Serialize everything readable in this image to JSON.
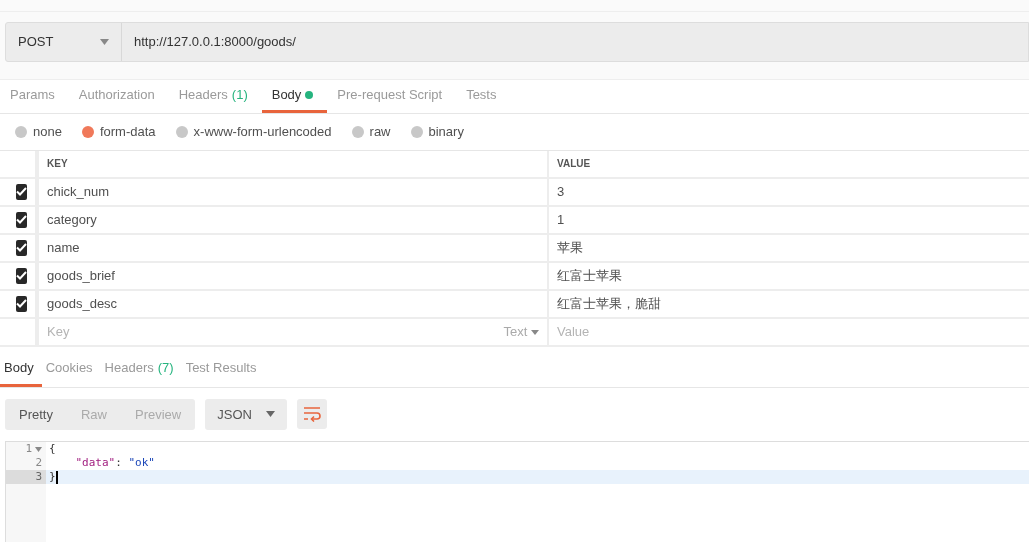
{
  "request": {
    "method": "POST",
    "url": "http://127.0.0.1:8000/goods/"
  },
  "request_tabs": [
    {
      "label": "Params",
      "selected": false
    },
    {
      "label": "Authorization",
      "selected": false
    },
    {
      "label": "Headers",
      "count": "(1)",
      "selected": false
    },
    {
      "label": "Body",
      "dot": true,
      "selected": true
    },
    {
      "label": "Pre-request Script",
      "selected": false
    },
    {
      "label": "Tests",
      "selected": false
    }
  ],
  "body_types": [
    {
      "label": "none",
      "selected": false
    },
    {
      "label": "form-data",
      "selected": true
    },
    {
      "label": "x-www-form-urlencoded",
      "selected": false
    },
    {
      "label": "raw",
      "selected": false
    },
    {
      "label": "binary",
      "selected": false
    }
  ],
  "params": {
    "columns": [
      "KEY",
      "VALUE"
    ],
    "rows": [
      {
        "key": "chick_num",
        "value": "3",
        "checked": true
      },
      {
        "key": "category",
        "value": "1",
        "checked": true
      },
      {
        "key": "name",
        "value": "苹果",
        "checked": true
      },
      {
        "key": "goods_brief",
        "value": "红富士苹果",
        "checked": true
      },
      {
        "key": "goods_desc",
        "value": "红富士苹果，脆甜",
        "checked": true
      }
    ],
    "new_row": {
      "key_placeholder": "Key",
      "type": "Text",
      "value_placeholder": "Value"
    }
  },
  "response_tabs": [
    {
      "label": "Body",
      "selected": true
    },
    {
      "label": "Cookies",
      "selected": false
    },
    {
      "label": "Headers",
      "count": "(7)",
      "selected": false
    },
    {
      "label": "Test Results",
      "selected": false
    }
  ],
  "view_modes": [
    {
      "label": "Pretty",
      "selected": true
    },
    {
      "label": "Raw",
      "selected": false
    },
    {
      "label": "Preview",
      "selected": false
    }
  ],
  "format": "JSON",
  "code": [
    {
      "number": "1",
      "foldable": true,
      "selected": false,
      "tokens": [
        {
          "kind": "punct",
          "text": "{"
        }
      ]
    },
    {
      "number": "2",
      "foldable": false,
      "selected": false,
      "tokens": [
        {
          "kind": "key",
          "text": "    \"data\""
        },
        {
          "kind": "punct",
          "text": ": "
        },
        {
          "kind": "string",
          "text": "\"ok\""
        }
      ]
    },
    {
      "number": "3",
      "foldable": false,
      "selected": true,
      "tokens": [
        {
          "kind": "punct",
          "text": "}"
        }
      ]
    }
  ]
}
